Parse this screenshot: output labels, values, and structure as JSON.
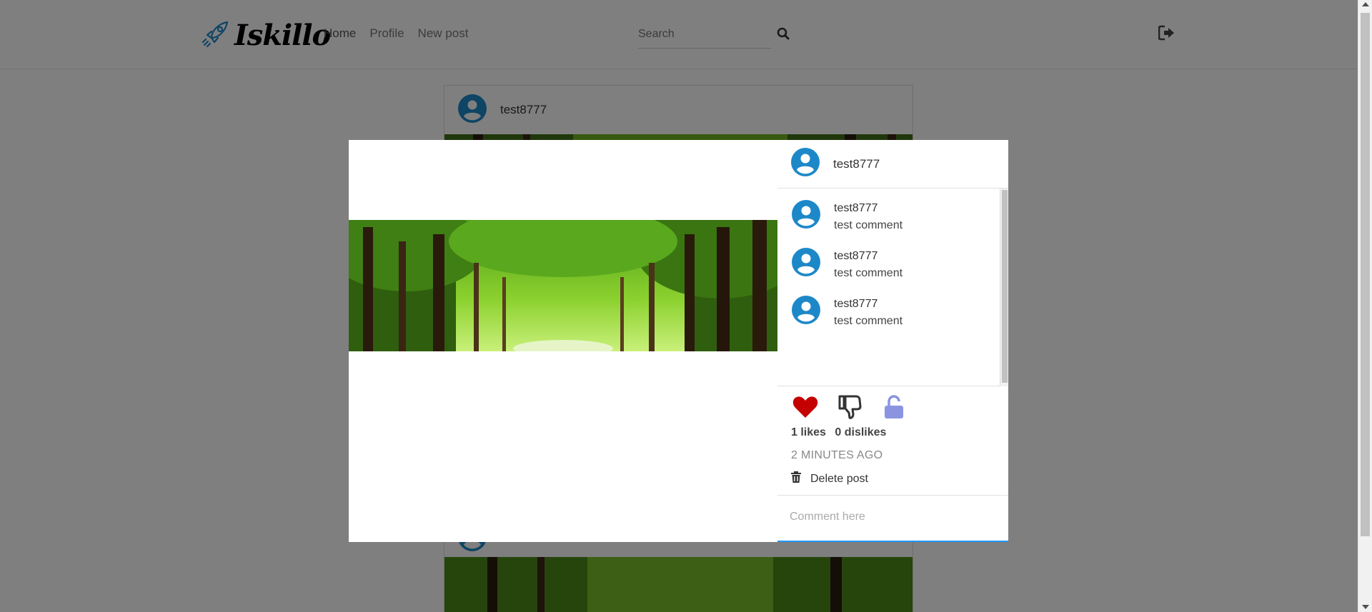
{
  "app": {
    "logo_text": "Iskillo",
    "nav": {
      "home": "Home",
      "profile": "Profile",
      "new_post": "New post"
    },
    "search": {
      "placeholder": "Search"
    }
  },
  "background_post": {
    "username": "test8777"
  },
  "modal": {
    "username": "test8777",
    "comments": [
      {
        "user": "test8777",
        "text": "test comment"
      },
      {
        "user": "test8777",
        "text": "test comment"
      },
      {
        "user": "test8777",
        "text": "test comment"
      }
    ],
    "likes_label": "1 likes",
    "dislikes_label": "0 dislikes",
    "time_label": "2 MINUTES AGO",
    "delete_label": "Delete post",
    "comment_placeholder": "Comment here"
  },
  "colors": {
    "like_red": "#c40000",
    "lock_purple": "#8a94e0",
    "avatar_blue": "#1d88c8",
    "input_focus_blue": "#2196f3"
  },
  "icons": [
    "rocket-icon",
    "search-icon",
    "logout-icon",
    "user-avatar-icon",
    "heart-icon",
    "thumbs-down-icon",
    "unlock-icon",
    "trash-icon"
  ]
}
